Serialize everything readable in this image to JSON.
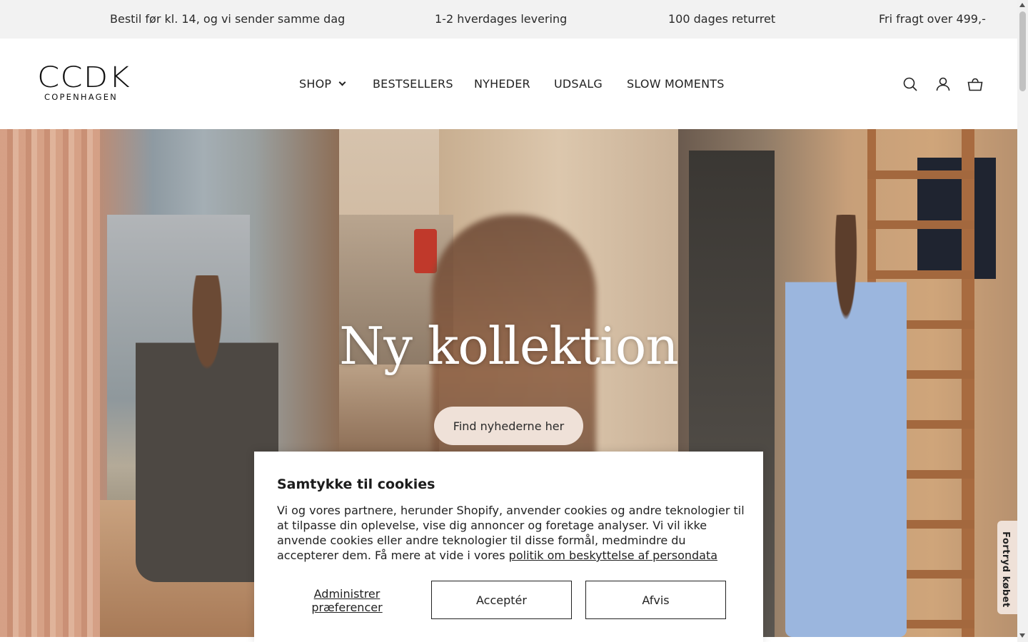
{
  "announcement": {
    "items": [
      "Bestil før kl. 14, og vi sender samme dag",
      "1-2 hverdages levering",
      "100 dages returret",
      "Fri fragt over 499,-"
    ]
  },
  "header": {
    "logo_main": "CCDK",
    "logo_sub": "COPENHAGEN",
    "nav": [
      "SHOP",
      "BESTSELLERS",
      "NYHEDER",
      "UDSALG",
      "SLOW MOMENTS"
    ],
    "icons": [
      "search-icon",
      "account-icon",
      "cart-icon"
    ]
  },
  "hero": {
    "title": "Ny kollektion",
    "button_label": "Find nyhederne her"
  },
  "cookie": {
    "title": "Samtykke til cookies",
    "body": "Vi og vores partnere, herunder Shopify, anvender cookies og andre teknologier til at tilpasse din oplevelse, vise dig annoncer og foretage analyser. Vi vil ikke anvende cookies eller andre teknologier til disse formål, medmindre du accepterer dem. Få mere at vide i vores",
    "link_text": "politik om beskyttelse af persondata",
    "manage_label": "Administrer præferencer",
    "accept_label": "Acceptér",
    "decline_label": "Afvis"
  },
  "side_tab": {
    "label": "Fortryd købet"
  },
  "colors": {
    "announcement_bg": "#f2f2f2",
    "accent_button": "#efe1d8",
    "text": "#1c1c1c"
  }
}
